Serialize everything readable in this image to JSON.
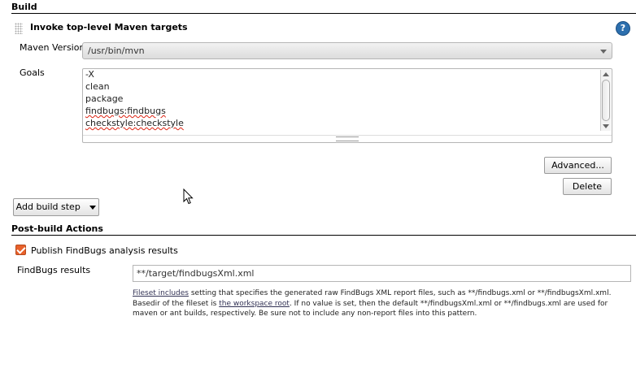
{
  "build": {
    "section_title": "Build",
    "step_title": "Invoke top-level Maven targets",
    "help_label": "?",
    "maven_version_label": "Maven Version",
    "maven_version_value": "/usr/bin/mvn",
    "goals_label": "Goals",
    "goals": [
      "-X",
      "clean",
      "package",
      "findbugs:findbugs",
      "checkstyle:checkstyle"
    ],
    "advanced_button": "Advanced...",
    "delete_button": "Delete",
    "add_build_step_button": "Add build step"
  },
  "post_build": {
    "section_title": "Post-build Actions",
    "publish_label": "Publish FindBugs analysis results",
    "publish_checked": true,
    "results_label": "FindBugs results",
    "results_value": "**/target/findbugsXml.xml",
    "desc_link1": "Fileset includes",
    "desc_text1": " setting that specifies the generated raw FindBugs XML report files, such as **/findbugs.xml or **/findbugsXml.xml. Basedir of the fileset is ",
    "desc_link2": "the workspace root",
    "desc_text2": ". If no value is set, then the default **/findbugsXml.xml or **/findbugs.xml are used for maven or ant builds, respectively. Be sure not to include any non-report files into this pattern."
  },
  "colors": {
    "accent": "#e8612b",
    "help": "#2c6fae"
  }
}
